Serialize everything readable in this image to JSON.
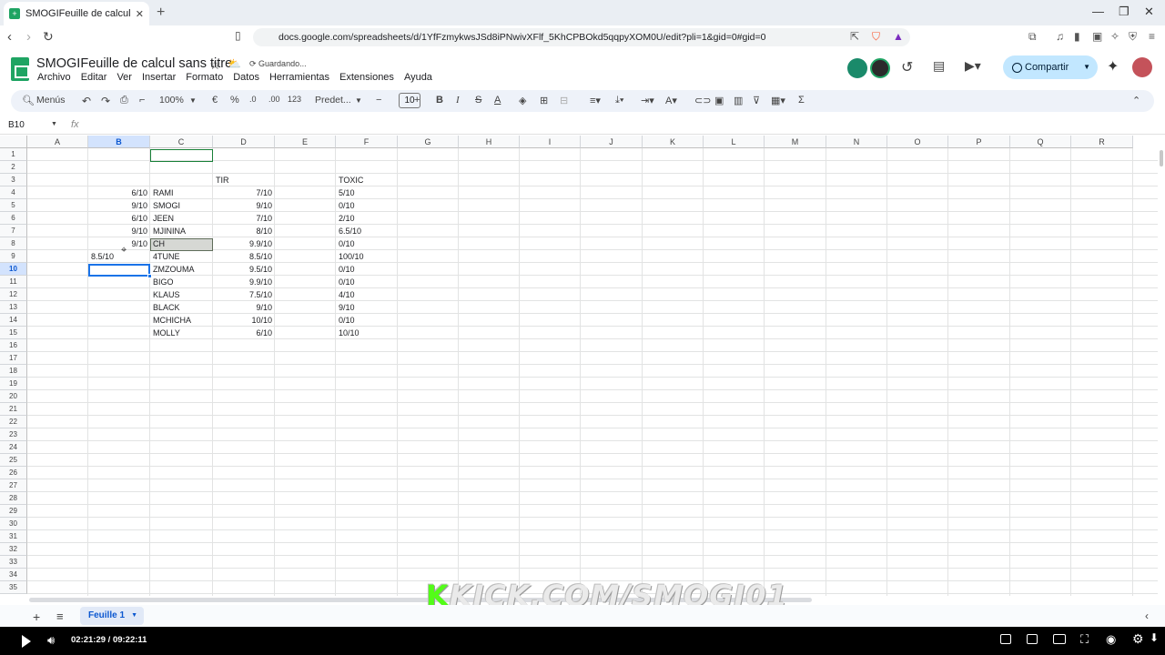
{
  "browser": {
    "tab_title": "SMOGIFeuille de calcul sans titre",
    "url": "docs.google.com/spreadsheets/d/1YfFzmykwsJSd8iPNwivXFlf_5KhCPBOkd5qqpyXOM0U/edit?pli=1&gid=0#gid=0"
  },
  "doc": {
    "title": "SMOGIFeuille de calcul sans titre",
    "status": "Guardando...",
    "menus": [
      "Archivo",
      "Editar",
      "Ver",
      "Insertar",
      "Formato",
      "Datos",
      "Herramientas",
      "Extensiones",
      "Ayuda"
    ],
    "share_label": "Compartir"
  },
  "toolbar": {
    "search_label": "Menús",
    "zoom": "100%",
    "currency": "€",
    "percent": "%",
    "dec_decrease": ".0",
    "dec_increase": ".00",
    "number_format": "123",
    "font": "Predet...",
    "font_size": "10"
  },
  "formula_bar": {
    "name_box": "B10",
    "fx": "fx"
  },
  "grid": {
    "columns": [
      "A",
      "B",
      "C",
      "D",
      "E",
      "F",
      "G",
      "H",
      "I",
      "J",
      "K",
      "L",
      "M",
      "N",
      "O",
      "P",
      "Q",
      "R"
    ],
    "selected_column": "B",
    "rows": [
      "1",
      "2",
      "3",
      "4",
      "5",
      "6",
      "7",
      "8",
      "9",
      "10",
      "11",
      "12",
      "13",
      "14",
      "15",
      "16",
      "17",
      "18",
      "19",
      "20",
      "21",
      "22",
      "23",
      "24",
      "25",
      "26",
      "27",
      "28",
      "29",
      "30",
      "31",
      "32",
      "33",
      "34",
      "35"
    ],
    "selected_row": "10",
    "cells": [
      {
        "ref": "D3",
        "value": "TIR"
      },
      {
        "ref": "F3",
        "value": "TOXIC"
      },
      {
        "ref": "B4",
        "value": "6/10"
      },
      {
        "ref": "C4",
        "value": "RAMI"
      },
      {
        "ref": "D4",
        "value": "7/10"
      },
      {
        "ref": "F4",
        "value": "5/10"
      },
      {
        "ref": "B5",
        "value": "9/10"
      },
      {
        "ref": "C5",
        "value": "SMOGI"
      },
      {
        "ref": "D5",
        "value": "9/10"
      },
      {
        "ref": "F5",
        "value": "0/10"
      },
      {
        "ref": "B6",
        "value": "6/10"
      },
      {
        "ref": "C6",
        "value": "JEEN"
      },
      {
        "ref": "D6",
        "value": "7/10"
      },
      {
        "ref": "F6",
        "value": "2/10"
      },
      {
        "ref": "B7",
        "value": "9/10"
      },
      {
        "ref": "C7",
        "value": "MJININA"
      },
      {
        "ref": "D7",
        "value": "8/10"
      },
      {
        "ref": "F7",
        "value": "6.5/10"
      },
      {
        "ref": "B8",
        "value": "9/10"
      },
      {
        "ref": "C8",
        "value": "CH"
      },
      {
        "ref": "D8",
        "value": "9.9/10"
      },
      {
        "ref": "F8",
        "value": "0/10"
      },
      {
        "ref": "B9",
        "value": "8.5/10"
      },
      {
        "ref": "C9",
        "value": "4TUNE"
      },
      {
        "ref": "D9",
        "value": "8.5/10"
      },
      {
        "ref": "F9",
        "value": "100/10"
      },
      {
        "ref": "C10",
        "value": "ZMZOUMA"
      },
      {
        "ref": "D10",
        "value": "9.5/10"
      },
      {
        "ref": "F10",
        "value": "0/10"
      },
      {
        "ref": "C11",
        "value": "BIGO"
      },
      {
        "ref": "D11",
        "value": "9.9/10"
      },
      {
        "ref": "F11",
        "value": "0/10"
      },
      {
        "ref": "C12",
        "value": "KLAUS"
      },
      {
        "ref": "D12",
        "value": "7.5/10"
      },
      {
        "ref": "F12",
        "value": "4/10"
      },
      {
        "ref": "C13",
        "value": "BLACK"
      },
      {
        "ref": "D13",
        "value": "9/10"
      },
      {
        "ref": "F13",
        "value": "9/10"
      },
      {
        "ref": "C14",
        "value": "MCHICHA"
      },
      {
        "ref": "D14",
        "value": "10/10"
      },
      {
        "ref": "F14",
        "value": "0/10"
      },
      {
        "ref": "C15",
        "value": "MOLLY"
      },
      {
        "ref": "D15",
        "value": "6/10"
      },
      {
        "ref": "F15",
        "value": "10/10"
      }
    ]
  },
  "sheets": {
    "active": "Feuille 1"
  },
  "player": {
    "timecode": "02:21:29 / 09:22:11"
  },
  "watermark": {
    "k": "K",
    "text": "KICK.COM/SMOGI01"
  }
}
